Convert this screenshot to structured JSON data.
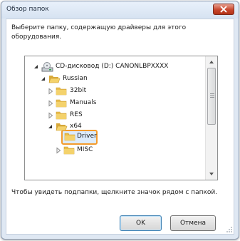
{
  "window": {
    "title": "Обзор папок"
  },
  "description": "Выберите папку, содержащую драйверы для этого оборудования.",
  "tree": {
    "items": [
      {
        "label": "CD-дисковод (D:) CANONLBPXXXX",
        "icon": "cd-drive-icon",
        "expanded": true
      },
      {
        "label": "Russian",
        "icon": "folder-open-icon",
        "expanded": true
      },
      {
        "label": "32bit",
        "icon": "folder-icon",
        "expanded": false
      },
      {
        "label": "Manuals",
        "icon": "folder-icon",
        "expanded": false
      },
      {
        "label": "RES",
        "icon": "folder-icon",
        "expanded": false
      },
      {
        "label": "x64",
        "icon": "folder-open-icon",
        "expanded": true
      },
      {
        "label": "Driver",
        "icon": "folder-icon",
        "selected": true
      },
      {
        "label": "MISC",
        "icon": "folder-icon",
        "expanded": false
      }
    ]
  },
  "hint": "Чтобы увидеть подпапки, щелкните значок рядом с папкой.",
  "buttons": {
    "ok": "OK",
    "cancel": "Отмена"
  },
  "colors": {
    "selection_highlight": "#f39b2d",
    "selection_fill": "#dcebfc",
    "close_button": "#c8462d"
  }
}
